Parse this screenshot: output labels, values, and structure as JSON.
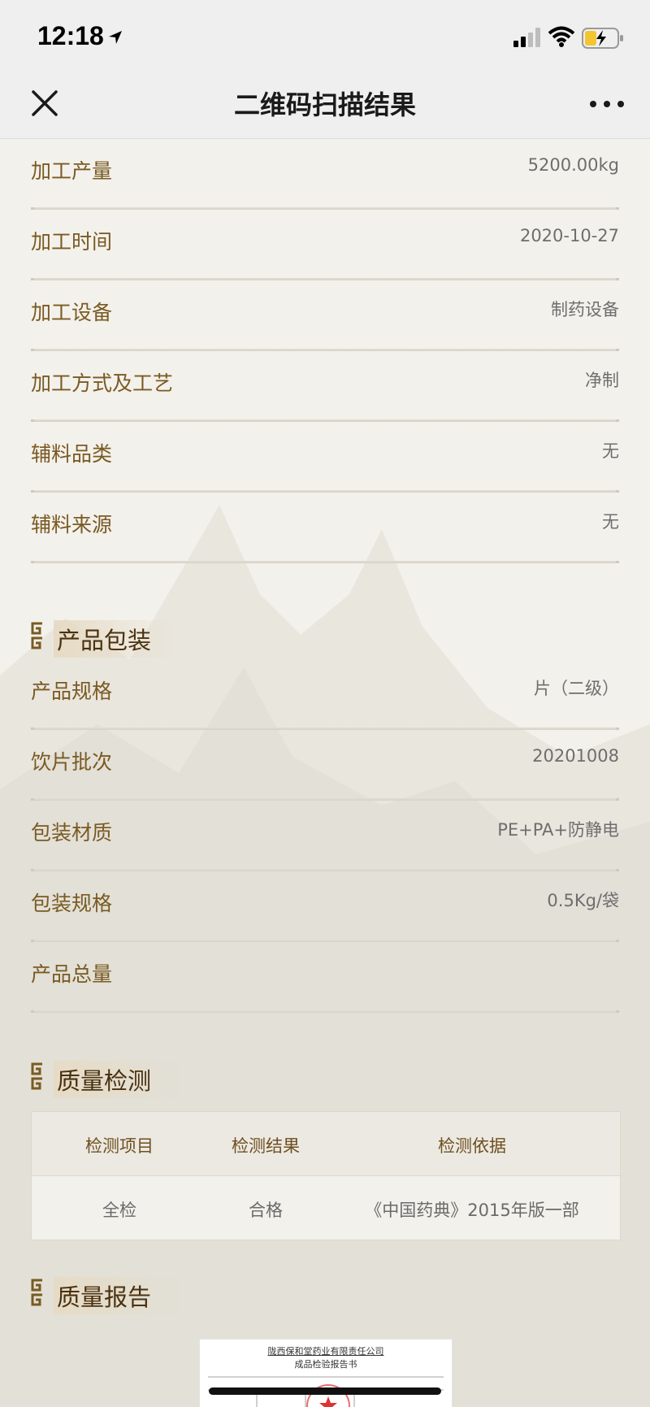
{
  "status_bar": {
    "time": "12:18"
  },
  "nav": {
    "title": "二维码扫描结果"
  },
  "processing_rows": [
    {
      "label": "加工产量",
      "value": "5200.00kg"
    },
    {
      "label": "加工时间",
      "value": "2020-10-27"
    },
    {
      "label": "加工设备",
      "value": "制药设备"
    },
    {
      "label": "加工方式及工艺",
      "value": "净制"
    },
    {
      "label": "辅料品类",
      "value": "无"
    },
    {
      "label": "辅料来源",
      "value": "无"
    }
  ],
  "packaging": {
    "title": "产品包装",
    "rows": [
      {
        "label": "产品规格",
        "value": "片（二级）"
      },
      {
        "label": "饮片批次",
        "value": "20201008"
      },
      {
        "label": "包装材质",
        "value": "PE+PA+防静电"
      },
      {
        "label": "包装规格",
        "value": "0.5Kg/袋"
      },
      {
        "label": "产品总量",
        "value": ""
      }
    ]
  },
  "quality_check": {
    "title": "质量检测",
    "headers": [
      "检测项目",
      "检测结果",
      "检测依据"
    ],
    "row": [
      "全检",
      "合格",
      "《中国药典》2015年版一部"
    ]
  },
  "quality_report": {
    "title": "质量报告",
    "doc_company": "陇西保和堂药业有限责任公司",
    "doc_title": "成品检验报告书"
  },
  "colors": {
    "label": "#7a5a22",
    "section_title": "#4a3210",
    "value": "#6e6e6e",
    "background": "#f3f1ec"
  }
}
